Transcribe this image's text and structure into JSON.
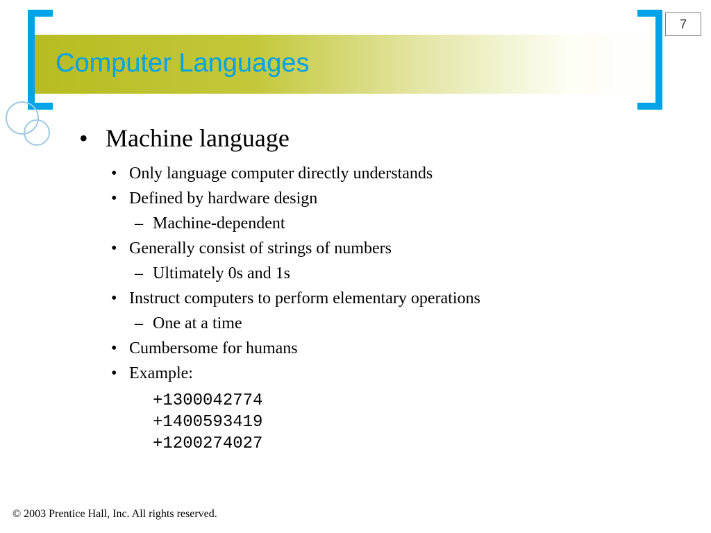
{
  "page_number": "7",
  "title": "Computer Languages",
  "heading": "Machine language",
  "bullets": {
    "b0": "Only language computer directly understands",
    "b1": "Defined by hardware design",
    "b1s0": "Machine-dependent",
    "b2": "Generally consist of strings of numbers",
    "b2s0": "Ultimately 0s and 1s",
    "b3": "Instruct computers to perform elementary operations",
    "b3s0": "One at a time",
    "b4": "Cumbersome for humans",
    "b5": "Example:"
  },
  "code": "+1300042774\n+1400593419\n+1200274027",
  "footer": "© 2003 Prentice Hall, Inc.  All rights reserved."
}
